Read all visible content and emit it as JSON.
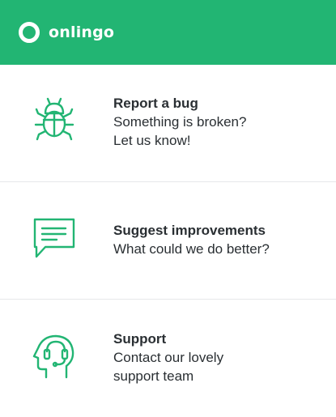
{
  "app": {
    "brand": "onlingo",
    "accent_color": "#22b573",
    "text_color": "#2a2f33"
  },
  "menu": {
    "items": [
      {
        "icon": "bug-icon",
        "title": "Report a bug",
        "description": "Something is broken?\nLet us know!"
      },
      {
        "icon": "chat-bubble-icon",
        "title": "Suggest improvements",
        "description": "What could we do better?"
      },
      {
        "icon": "headset-support-icon",
        "title": "Support",
        "description": "Contact our lovely\nsupport team"
      }
    ]
  }
}
